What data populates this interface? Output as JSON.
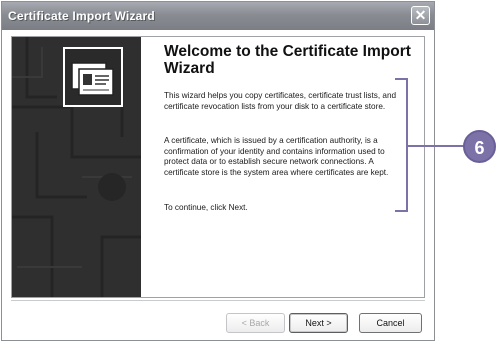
{
  "window": {
    "title": "Certificate Import Wizard",
    "close_glyph": "✕"
  },
  "main": {
    "heading": "Welcome to the Certificate Import Wizard",
    "paragraphs": [
      "This wizard helps you copy certificates, certificate trust lists, and certificate revocation lists from your disk to a certificate store.",
      "A certificate, which is issued by a certification authority, is a confirmation of your identity and contains information used to protect data or to establish secure network connections. A certificate store is the system area where certificates are kept.",
      "To continue, click Next."
    ]
  },
  "buttons": {
    "back": "< Back",
    "next": "Next >",
    "cancel": "Cancel"
  },
  "callout": {
    "number": "6"
  },
  "colors": {
    "callout_accent": "#7c72a8",
    "titlebar": "#898c92"
  },
  "icons": {
    "wizard_banner": "certificate-icon",
    "close": "close-icon"
  }
}
